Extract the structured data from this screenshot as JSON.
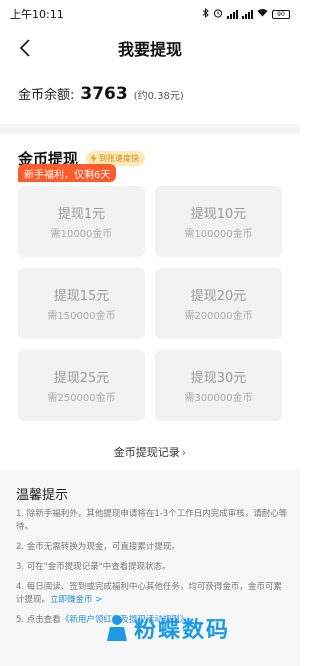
{
  "status": {
    "time": "上午10:11",
    "battery": "90"
  },
  "nav": {
    "title": "我要提现"
  },
  "balance": {
    "label": "金币余额:",
    "value": "3763",
    "approx": "(约0.38元)"
  },
  "section": {
    "title": "金币提现",
    "badge": "到账速度快"
  },
  "promo_tag": "新手福利，仅剩6天",
  "options": [
    {
      "amount": "提现1元",
      "cost": "需10000金币"
    },
    {
      "amount": "提现10元",
      "cost": "需100000金币"
    },
    {
      "amount": "提现15元",
      "cost": "需150000金币"
    },
    {
      "amount": "提现20元",
      "cost": "需200000金币"
    },
    {
      "amount": "提现25元",
      "cost": "需250000金币"
    },
    {
      "amount": "提现30元",
      "cost": "需300000金币"
    }
  ],
  "record_link": "金币提现记录",
  "tips": {
    "title": "温馨提示",
    "items": [
      "1. 除新手福利外，其他提现申请将在1-3个工作日内完成审核，请耐心等待。",
      "2. 金币无需转换为现金，可直接累计提现。",
      "3. 可在\"金币提现记录\"中查看提现状态。",
      "4. 每日阅读、签到或完成福利中心其他任务，均可获得金币，金币可累计提现。",
      "5. 点击查看"
    ],
    "earn_link": "立即赚金币 >",
    "rules_link": "《新用户领红包及提现活动规则》"
  },
  "watermark": "粉蝶数码",
  "colors": {
    "promo": "#fe5a2a",
    "badge_bg": "#fde9b8",
    "link": "#2b8fd6",
    "watermark": "#1c9ae8"
  }
}
